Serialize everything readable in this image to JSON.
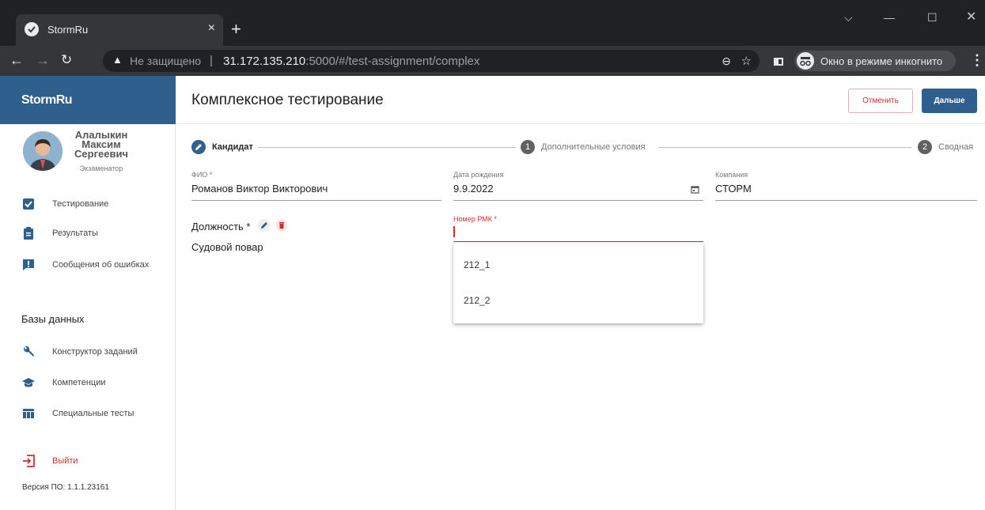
{
  "browser": {
    "tab_title": "StormRu",
    "tab_close": "×",
    "new_tab": "+",
    "security_text": "Не защищено",
    "url_host": "31.172.135.210",
    "url_rest": ":5000/#/test-assignment/complex",
    "incognito_label": "Окно в режиме инкогнито"
  },
  "sidebar": {
    "brand": "StormRu",
    "user_name": "Алалыкин Максим Сергеевич",
    "user_role": "Экзаменатор",
    "items": [
      {
        "label": "Тестирование"
      },
      {
        "label": "Результаты"
      },
      {
        "label": "Сообщения об ошибках"
      }
    ],
    "section_title": "Базы данных",
    "db_items": [
      {
        "label": "Конструктор заданий"
      },
      {
        "label": "Компетенции"
      },
      {
        "label": "Специальные тесты"
      }
    ],
    "logout": "Выйти",
    "version": "Версия ПО: 1.1.1.23161"
  },
  "header": {
    "title": "Комплексное тестирование",
    "cancel_label": "Отменить",
    "next_label": "Дальше"
  },
  "stepper": {
    "steps": [
      {
        "label": "Кандидат",
        "marker": "",
        "active": true
      },
      {
        "label": "Дополнительные условия",
        "marker": "1",
        "active": false
      },
      {
        "label": "Сводная",
        "marker": "2",
        "active": false
      }
    ]
  },
  "form": {
    "fio_label": "ФИО *",
    "fio_value": "Романов Виктор Викторович",
    "dob_label": "Дата рождения",
    "dob_value": "9.9.2022",
    "company_label": "Компания",
    "company_value": "СТОРМ",
    "position_label": "Должность *",
    "position_value": "Судовой повар",
    "rmk_label": "Номер РМК *",
    "rmk_value": ""
  },
  "rmk_options": [
    "212_1",
    "212_2"
  ],
  "colors": {
    "brand": "#2f5f8c",
    "error": "#d32f2f"
  }
}
